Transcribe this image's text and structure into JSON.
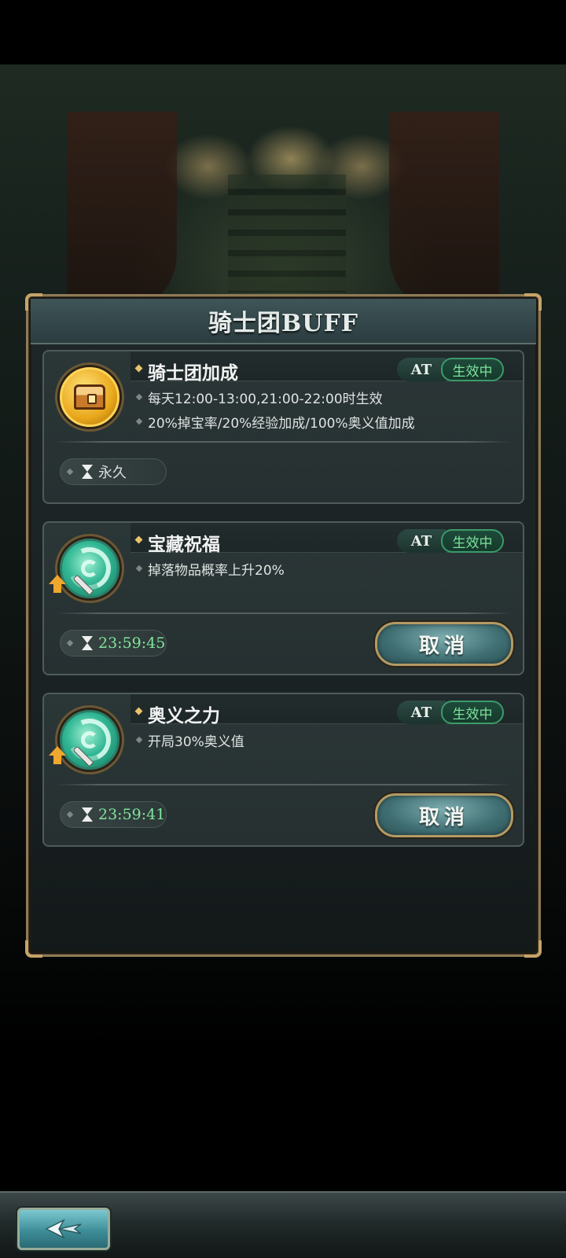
{
  "dialog": {
    "title": "骑士团BUFF"
  },
  "buffs": [
    {
      "name": "骑士团加成",
      "icon": "treasure-chest-icon",
      "tag": "AT",
      "status": "生效中",
      "descriptions": [
        "每天12:00-13:00,21:00-22:00时生效",
        "20%掉宝率/20%经验加成/100%奥义值加成"
      ],
      "duration": "永久",
      "has_cancel": false
    },
    {
      "name": "宝藏祝福",
      "icon": "green-swirl-icon",
      "tag": "AT",
      "status": "生效中",
      "descriptions": [
        "掉落物品概率上升20%"
      ],
      "duration": "23:59:45",
      "cancel_label": "取消",
      "has_cancel": true
    },
    {
      "name": "奥义之力",
      "icon": "green-swirl-icon",
      "tag": "AT",
      "status": "生效中",
      "descriptions": [
        "开局30%奥义值"
      ],
      "duration": "23:59:41",
      "cancel_label": "取消",
      "has_cancel": true
    }
  ],
  "bottom_bar": {
    "back_icon": "back-arrow-icon"
  },
  "colors": {
    "frame_gold": "#8e7a56",
    "status_green": "#7de09b",
    "timer_green": "#7fe59c",
    "button_teal": "#3f6e72"
  }
}
